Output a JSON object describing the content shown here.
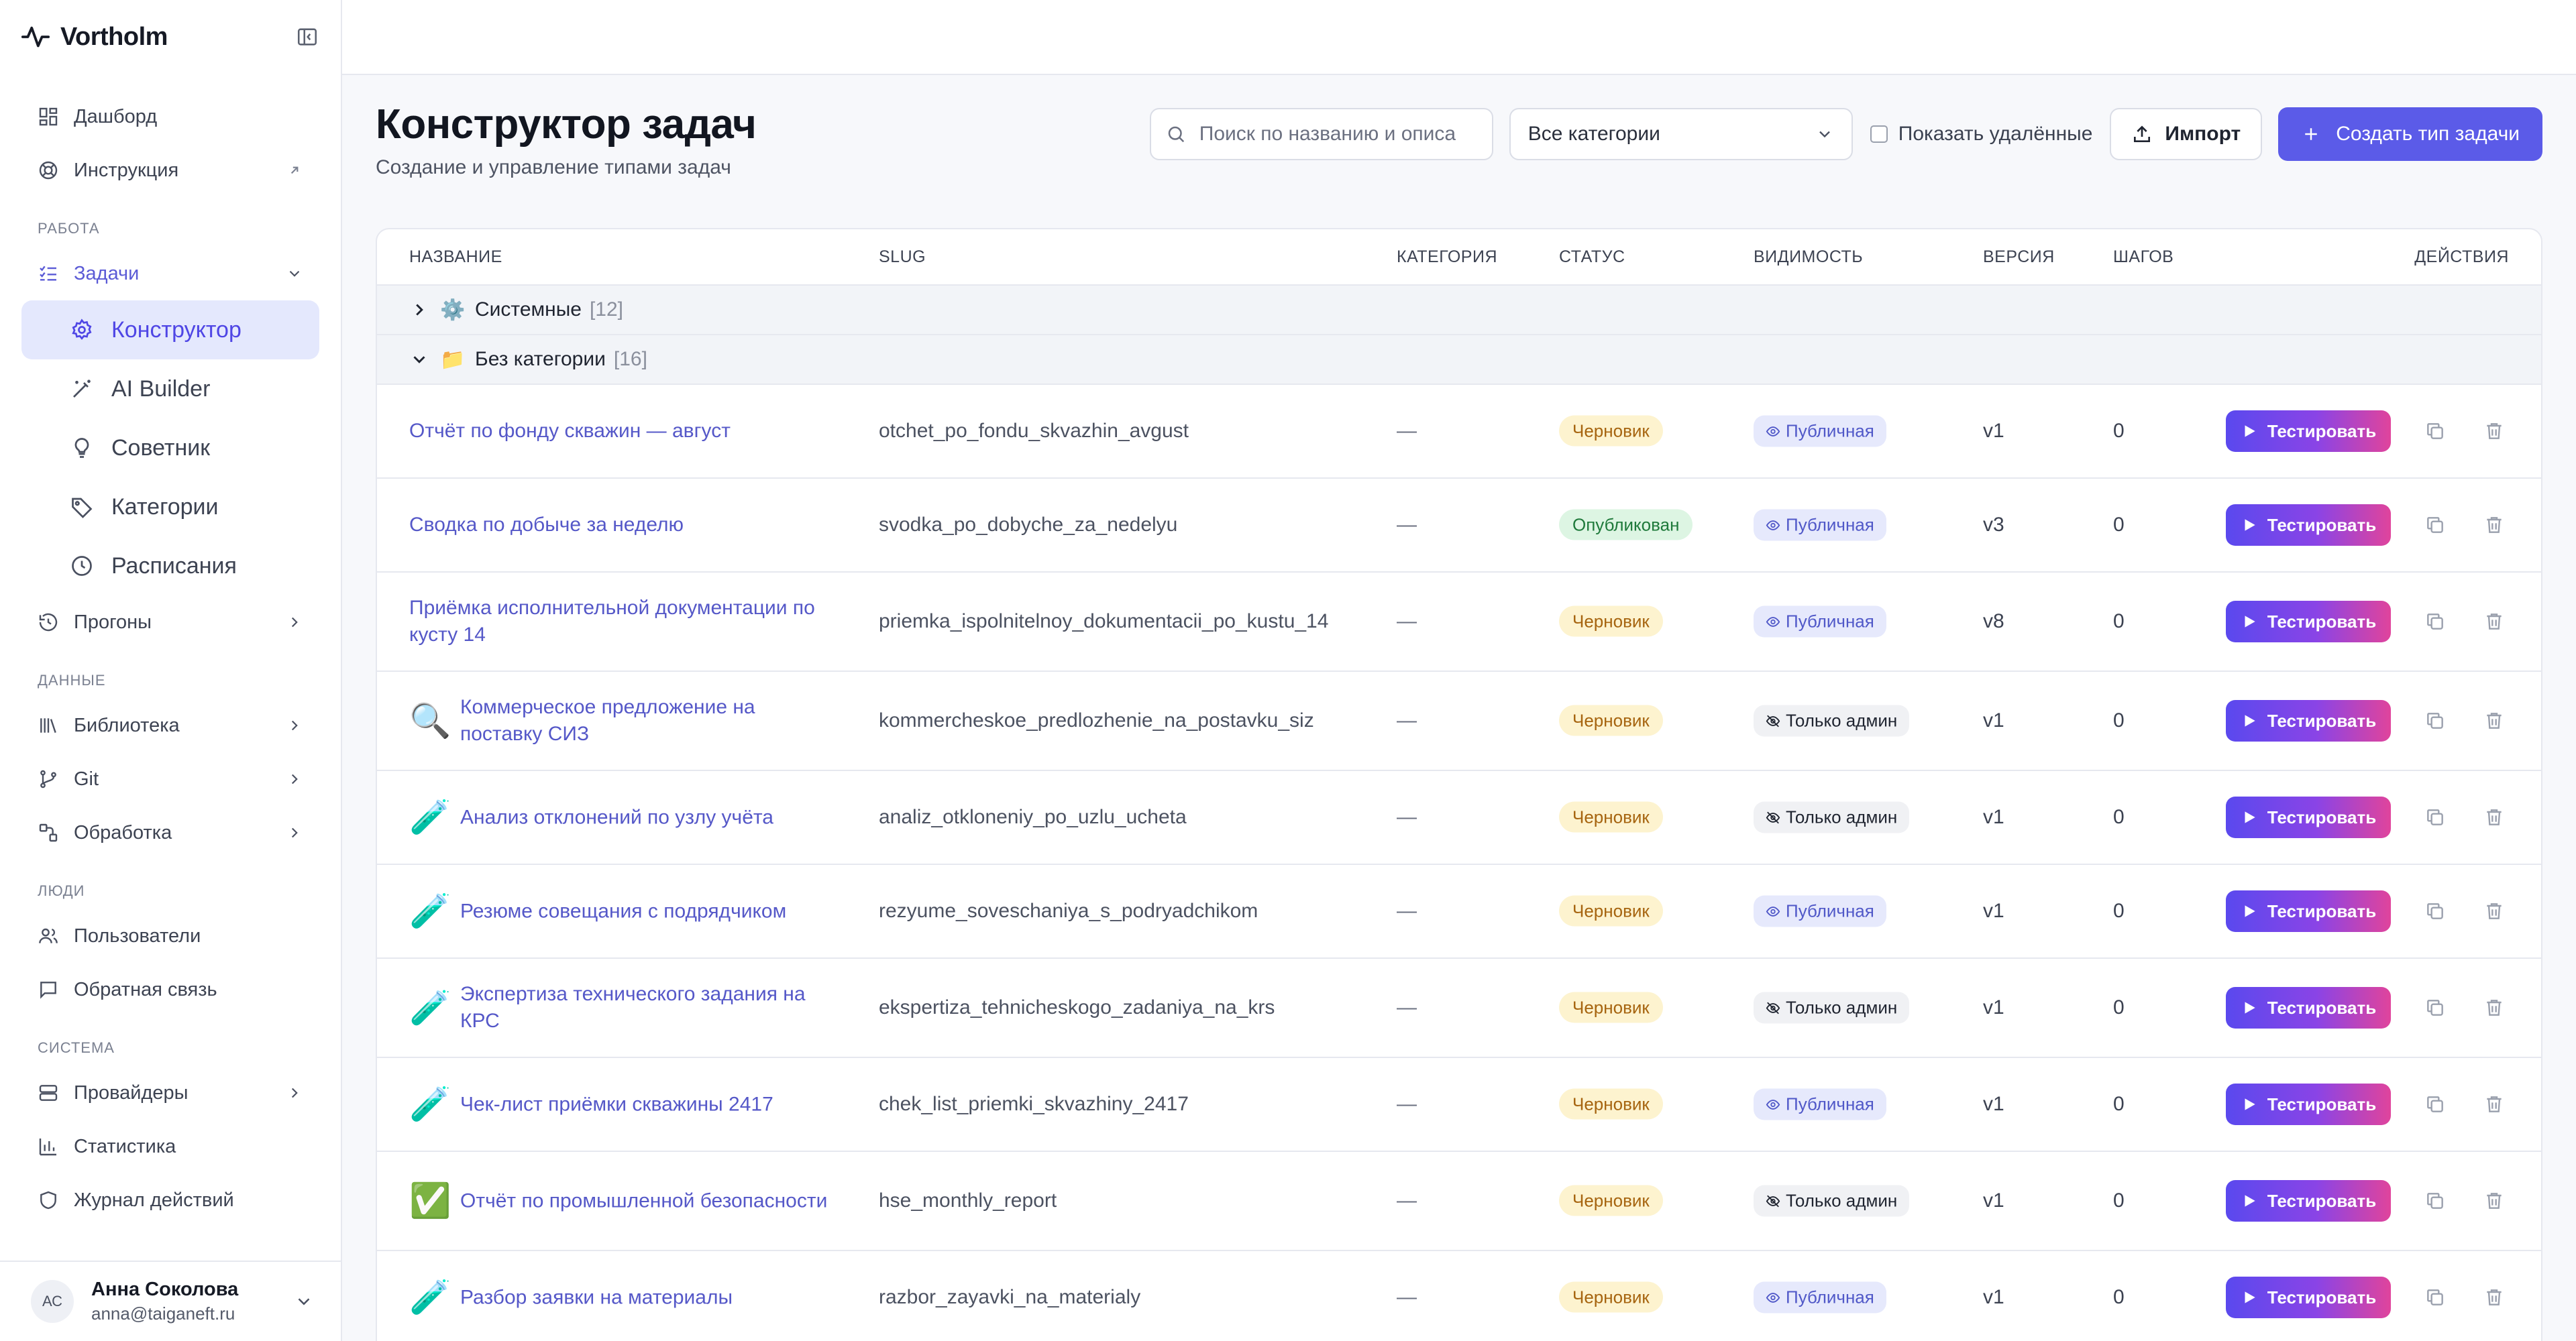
{
  "brand": {
    "name": "Vortholm"
  },
  "sidebar": {
    "top_items": [
      {
        "label": "Дашборд",
        "icon": "dashboard-icon"
      },
      {
        "label": "Инструкция",
        "icon": "help-circle-icon"
      }
    ],
    "sections": {
      "work": "РАБОТА",
      "data": "ДАННЫЕ",
      "people": "ЛЮДИ",
      "system": "СИСТЕМА"
    },
    "tasks": {
      "label": "Задачи",
      "children": [
        {
          "label": "Конструктор",
          "icon": "gear-icon"
        },
        {
          "label": "AI Builder",
          "icon": "magic-wand-icon"
        },
        {
          "label": "Советник",
          "icon": "lightbulb-icon"
        },
        {
          "label": "Категории",
          "icon": "tag-icon"
        },
        {
          "label": "Расписания",
          "icon": "clock-icon"
        }
      ]
    },
    "runs": {
      "label": "Прогоны"
    },
    "data_items": [
      {
        "label": "Библиотека",
        "icon": "library-icon"
      },
      {
        "label": "Git",
        "icon": "git-branch-icon"
      },
      {
        "label": "Обработка",
        "icon": "workflow-icon"
      }
    ],
    "people_items": [
      {
        "label": "Пользователи",
        "icon": "users-icon"
      },
      {
        "label": "Обратная связь",
        "icon": "message-icon"
      }
    ],
    "system_items": [
      {
        "label": "Провайдеры",
        "icon": "server-icon"
      },
      {
        "label": "Статистика",
        "icon": "bar-chart-icon"
      },
      {
        "label": "Журнал действий",
        "icon": "shield-icon"
      }
    ]
  },
  "user": {
    "initials": "АС",
    "name": "Анна Соколова",
    "email": "anna@taiganeft.ru"
  },
  "page": {
    "title": "Конструктор задач",
    "subtitle": "Создание и управление типами задач"
  },
  "toolbar": {
    "search_placeholder": "Поиск по названию и описа",
    "category_selected": "Все категории",
    "show_deleted_label": "Показать удалённые",
    "import_label": "Импорт",
    "create_label": "Создать тип задачи"
  },
  "table": {
    "columns": [
      "НАЗВАНИЕ",
      "SLUG",
      "КАТЕГОРИЯ",
      "СТАТУС",
      "ВИДИМОСТЬ",
      "ВЕРСИЯ",
      "ШАГОВ",
      "ДЕЙСТВИЯ"
    ],
    "groups": [
      {
        "icon": "⚙️",
        "name": "Системные",
        "count": "[12]",
        "expanded": false
      },
      {
        "icon": "📁",
        "name": "Без категории",
        "count": "[16]",
        "expanded": true
      }
    ],
    "test_label": "Тестировать",
    "rows": [
      {
        "emoji": "",
        "name": "Отчёт по фонду скважин — август",
        "slug": "otchet_po_fondu_skvazhin_avgust",
        "category": "—",
        "status": "Черновик",
        "status_kind": "draft",
        "visibility": "Публичная",
        "vis_kind": "public",
        "version": "v1",
        "steps": "0"
      },
      {
        "emoji": "",
        "name": "Сводка по добыче за неделю",
        "slug": "svodka_po_dobyche_za_nedelyu",
        "category": "—",
        "status": "Опубликован",
        "status_kind": "published",
        "visibility": "Публичная",
        "vis_kind": "public",
        "version": "v3",
        "steps": "0"
      },
      {
        "emoji": "",
        "name": "Приёмка исполнительной документации по кусту 14",
        "slug": "priemka_ispolnitelnoy_dokumentacii_po_kustu_14",
        "category": "—",
        "status": "Черновик",
        "status_kind": "draft",
        "visibility": "Публичная",
        "vis_kind": "public",
        "version": "v8",
        "steps": "0"
      },
      {
        "emoji": "🔍",
        "name": "Коммерческое предложение на поставку СИЗ",
        "slug": "kommercheskoe_predlozhenie_na_postavku_siz",
        "category": "—",
        "status": "Черновик",
        "status_kind": "draft",
        "visibility": "Только админ",
        "vis_kind": "admin",
        "version": "v1",
        "steps": "0"
      },
      {
        "emoji": "🧪",
        "name": "Анализ отклонений по узлу учёта",
        "slug": "analiz_otkloneniy_po_uzlu_ucheta",
        "category": "—",
        "status": "Черновик",
        "status_kind": "draft",
        "visibility": "Только админ",
        "vis_kind": "admin",
        "version": "v1",
        "steps": "0"
      },
      {
        "emoji": "🧪",
        "name": "Резюме совещания с подрядчиком",
        "slug": "rezyume_soveschaniya_s_podryadchikom",
        "category": "—",
        "status": "Черновик",
        "status_kind": "draft",
        "visibility": "Публичная",
        "vis_kind": "public",
        "version": "v1",
        "steps": "0"
      },
      {
        "emoji": "🧪",
        "name": "Экспертиза технического задания на КРС",
        "slug": "ekspertiza_tehnicheskogo_zadaniya_na_krs",
        "category": "—",
        "status": "Черновик",
        "status_kind": "draft",
        "visibility": "Только админ",
        "vis_kind": "admin",
        "version": "v1",
        "steps": "0"
      },
      {
        "emoji": "🧪",
        "name": "Чек-лист приёмки скважины 2417",
        "slug": "chek_list_priemki_skvazhiny_2417",
        "category": "—",
        "status": "Черновик",
        "status_kind": "draft",
        "visibility": "Публичная",
        "vis_kind": "public",
        "version": "v1",
        "steps": "0"
      },
      {
        "emoji": "✅",
        "name": "Отчёт по промышленной безопасности",
        "slug": "hse_monthly_report",
        "category": "—",
        "status": "Черновик",
        "status_kind": "draft",
        "visibility": "Только админ",
        "vis_kind": "admin",
        "version": "v1",
        "steps": "0"
      },
      {
        "emoji": "🧪",
        "name": "Разбор заявки на материалы",
        "slug": "razbor_zayavki_na_materialy",
        "category": "—",
        "status": "Черновик",
        "status_kind": "draft",
        "visibility": "Публичная",
        "vis_kind": "public",
        "version": "v1",
        "steps": "0"
      }
    ]
  },
  "colors": {
    "accent": "#5b5be8",
    "active_bg": "#e4e8fd",
    "link": "#5558c8",
    "draft_bg": "#fdf3cf",
    "published_bg": "#ddf5e3"
  }
}
